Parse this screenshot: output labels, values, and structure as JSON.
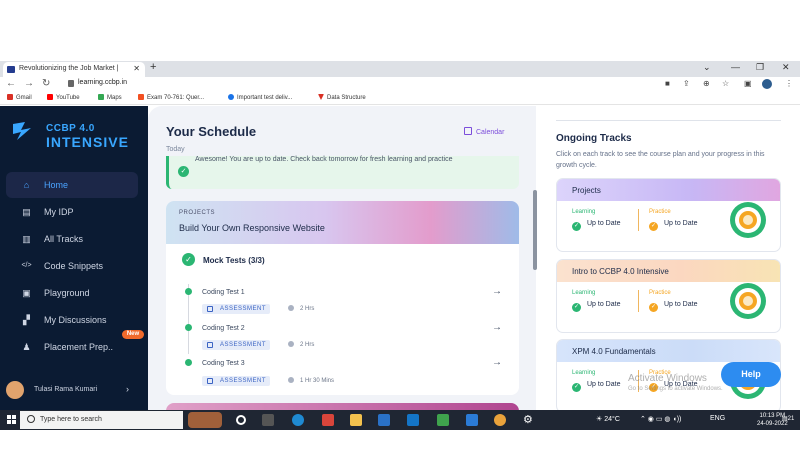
{
  "browser": {
    "tab_title": "Revolutionizing the Job Market |",
    "tab_close": "✕",
    "new_tab": "+",
    "url": "learning.ccbp.in",
    "bookmarks": [
      "Gmail",
      "YouTube",
      "Maps",
      "Exam 70-761: Quer...",
      "Important test deliv...",
      "Data Structure"
    ]
  },
  "app": {
    "logo_top": "CCBP 4.0",
    "logo_bottom": "INTENSIVE",
    "sidebar": [
      {
        "label": "Home",
        "icon": "home-icon"
      },
      {
        "label": "My IDP",
        "icon": "idp-icon"
      },
      {
        "label": "All Tracks",
        "icon": "tracks-icon"
      },
      {
        "label": "Code Snippets",
        "icon": "code-icon"
      },
      {
        "label": "Playground",
        "icon": "terminal-icon"
      },
      {
        "label": "My Discussions",
        "icon": "discussion-icon"
      },
      {
        "label": "Placement Prep..",
        "icon": "placement-icon"
      }
    ],
    "new_badge": "New",
    "user_name": "Tulasi Rama Kumari"
  },
  "schedule": {
    "title": "Your Schedule",
    "today": "Today",
    "calendar": "Calendar",
    "message": "Awesome! You are up to date. Check back tomorrow for fresh learning and practice",
    "project_caption": "PROJECTS",
    "project_title": "Build Your Own Responsive Website",
    "mock_tests": "Mock Tests (3/3)",
    "tests": [
      {
        "name": "Coding Test 1",
        "badge": "ASSESSMENT",
        "duration": "2 Hrs"
      },
      {
        "name": "Coding Test 2",
        "badge": "ASSESSMENT",
        "duration": "2 Hrs"
      },
      {
        "name": "Coding Test 3",
        "badge": "ASSESSMENT",
        "duration": "1 Hr 30 Mins"
      }
    ]
  },
  "tracks": {
    "title": "Ongoing Tracks",
    "subtitle": "Click on each track to see the course plan and your progress in this growth cycle.",
    "cards": [
      {
        "name": "Projects",
        "learning_label": "Learning",
        "practice_label": "Practice",
        "learning_value": "Up to Date",
        "practice_value": "Up to Date"
      },
      {
        "name": "Intro to CCBP 4.0 Intensive",
        "learning_label": "Learning",
        "practice_label": "Practice",
        "learning_value": "Up to Date",
        "practice_value": "Up to Date"
      },
      {
        "name": "XPM 4.0 Fundamentals",
        "learning_label": "Learning",
        "practice_label": "Practice",
        "learning_value": "Up to Date",
        "practice_value": "Up to Date"
      }
    ]
  },
  "help": "Help",
  "watermark": "Activate Windows",
  "watermark_sub": "Go to Settings to activate Windows.",
  "taskbar": {
    "search_placeholder": "Type here to search",
    "temperature": "24°C",
    "lang": "ENG",
    "time": "10:13 PM",
    "date": "24-09-2022",
    "notif": "21"
  },
  "colors": {
    "sidebar_bg": "#0b1b33",
    "accent": "#4aa3ff",
    "success": "#2bb673",
    "warning": "#f5a623"
  }
}
